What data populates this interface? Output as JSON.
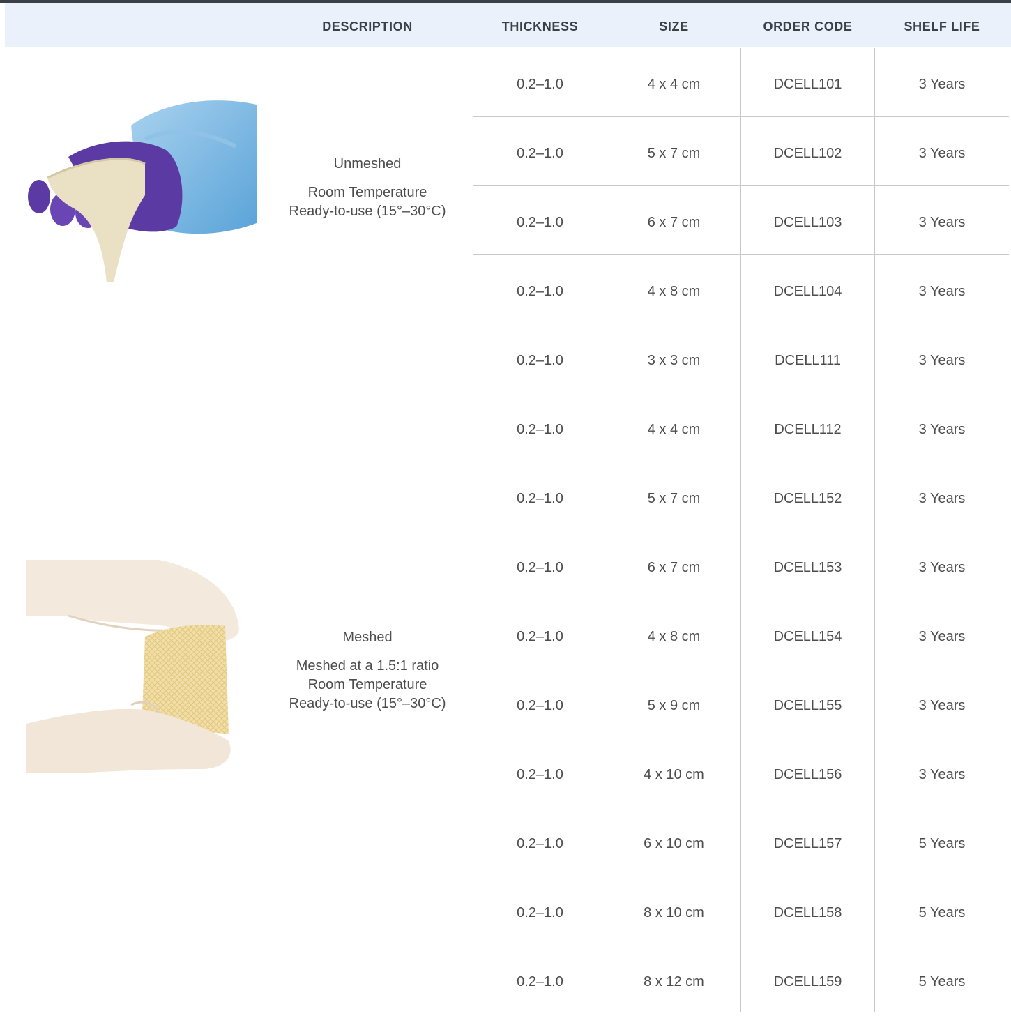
{
  "headers": {
    "description": "DESCRIPTION",
    "thickness": "THICKNESS",
    "size": "SIZE",
    "order_code": "ORDER CODE",
    "shelf_life": "SHELF LIFE"
  },
  "groups": [
    {
      "title": "Unmeshed",
      "lines": [
        "Room Temperature",
        "Ready-to-use (15°–30°C)"
      ],
      "image": "gloved-hand-holding-unmeshed-sheet",
      "rows": [
        {
          "thickness": "0.2–1.0",
          "size": "4 x 4 cm",
          "code": "DCELL101",
          "shelf": "3 Years"
        },
        {
          "thickness": "0.2–1.0",
          "size": "5 x 7 cm",
          "code": "DCELL102",
          "shelf": "3 Years"
        },
        {
          "thickness": "0.2–1.0",
          "size": "6 x 7 cm",
          "code": "DCELL103",
          "shelf": "3 Years"
        },
        {
          "thickness": "0.2–1.0",
          "size": "4 x 8 cm",
          "code": "DCELL104",
          "shelf": "3 Years"
        }
      ]
    },
    {
      "title": "Meshed",
      "lines": [
        "Meshed at a 1.5:1 ratio",
        "Room Temperature",
        "Ready-to-use (15°–30°C)"
      ],
      "image": "hands-stretching-meshed-sheet",
      "rows": [
        {
          "thickness": "0.2–1.0",
          "size": "3 x 3 cm",
          "code": "DCELL111",
          "shelf": "3 Years"
        },
        {
          "thickness": "0.2–1.0",
          "size": "4 x 4 cm",
          "code": "DCELL112",
          "shelf": "3 Years"
        },
        {
          "thickness": "0.2–1.0",
          "size": "5 x 7 cm",
          "code": "DCELL152",
          "shelf": "3 Years"
        },
        {
          "thickness": "0.2–1.0",
          "size": "6 x 7 cm",
          "code": "DCELL153",
          "shelf": "3 Years"
        },
        {
          "thickness": "0.2–1.0",
          "size": "4 x 8 cm",
          "code": "DCELL154",
          "shelf": "3 Years"
        },
        {
          "thickness": "0.2–1.0",
          "size": "5 x 9 cm",
          "code": "DCELL155",
          "shelf": "3 Years"
        },
        {
          "thickness": "0.2–1.0",
          "size": "4 x 10 cm",
          "code": "DCELL156",
          "shelf": "3 Years"
        },
        {
          "thickness": "0.2–1.0",
          "size": "6 x 10 cm",
          "code": "DCELL157",
          "shelf": "5 Years"
        },
        {
          "thickness": "0.2–1.0",
          "size": "8 x 10 cm",
          "code": "DCELL158",
          "shelf": "5 Years"
        },
        {
          "thickness": "0.2–1.0",
          "size": "8 x 12 cm",
          "code": "DCELL159",
          "shelf": "5 Years"
        }
      ]
    }
  ],
  "colors": {
    "header_bg": "#eaf1fa",
    "top_bar": "#3b3f46",
    "rule": "#c9c9c9",
    "text": "#4d4d4d"
  }
}
